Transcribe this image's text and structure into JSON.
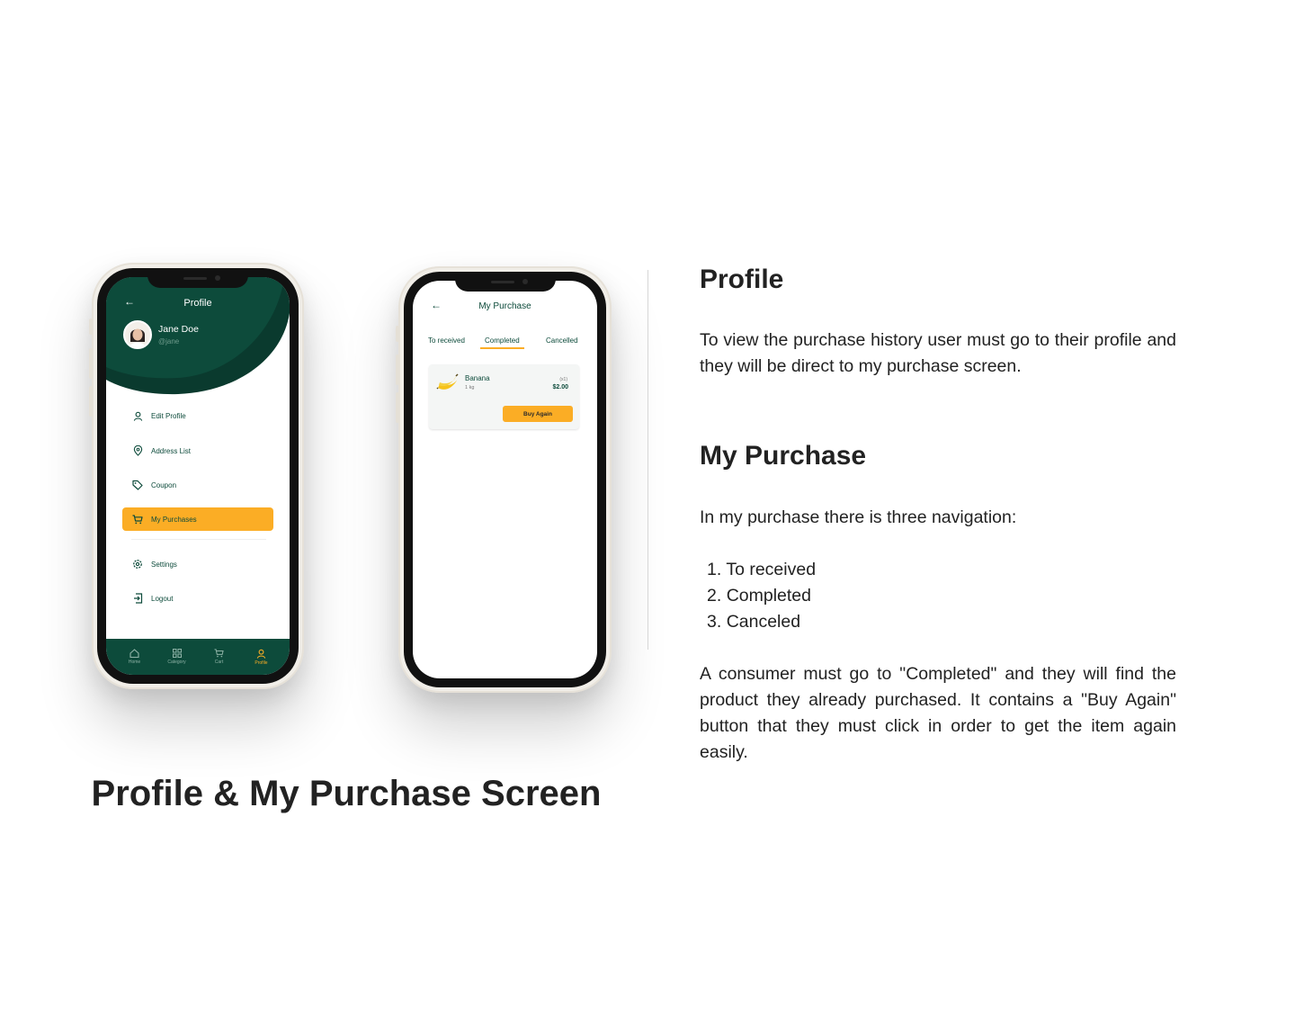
{
  "colors": {
    "brand_green": "#0d4b3b",
    "accent_yellow": "#fbad25",
    "muted_green": "#6e9b8c"
  },
  "profile_screen": {
    "title": "Profile",
    "user": {
      "name": "Jane Doe",
      "handle": "@jane"
    },
    "menu": [
      {
        "label": "Edit Profile",
        "icon": "user-icon"
      },
      {
        "label": "Address List",
        "icon": "location-pin-icon"
      },
      {
        "label": "Coupon",
        "icon": "tag-icon"
      },
      {
        "label": "My Purchases",
        "icon": "cart-icon",
        "active": true
      },
      {
        "label": "Settings",
        "icon": "gear-icon"
      },
      {
        "label": "Logout",
        "icon": "logout-icon"
      }
    ],
    "bottom_nav": [
      {
        "label": "Home",
        "icon": "home-icon"
      },
      {
        "label": "Category",
        "icon": "grid-icon"
      },
      {
        "label": "Cart",
        "icon": "cart-icon"
      },
      {
        "label": "Profile",
        "icon": "user-icon",
        "active": true
      }
    ]
  },
  "purchase_screen": {
    "title": "My Purchase",
    "tabs": [
      {
        "label": "To received"
      },
      {
        "label": "Completed",
        "active": true
      },
      {
        "label": "Cancelled"
      }
    ],
    "order": {
      "product_name": "Banana",
      "weight": "1 kg",
      "quantity": "(x1)",
      "price": "$2.00",
      "button_label": "Buy Again",
      "icon": "banana-icon"
    }
  },
  "description": {
    "profile_heading": "Profile",
    "profile_text": "To view the purchase history user must go to their profile and they will be direct to my purchase screen.",
    "purchase_heading": "My Purchase",
    "purchase_intro": "In my purchase there is three navigation:",
    "navigation_items": [
      "To received",
      "Completed",
      "Canceled"
    ],
    "purchase_text": "A consumer must go to \"Completed\" and they will find the product they already purchased. It contains a \"Buy Again\" button that they must click in order to get the item again easily."
  },
  "caption": "Profile & My Purchase Screen"
}
